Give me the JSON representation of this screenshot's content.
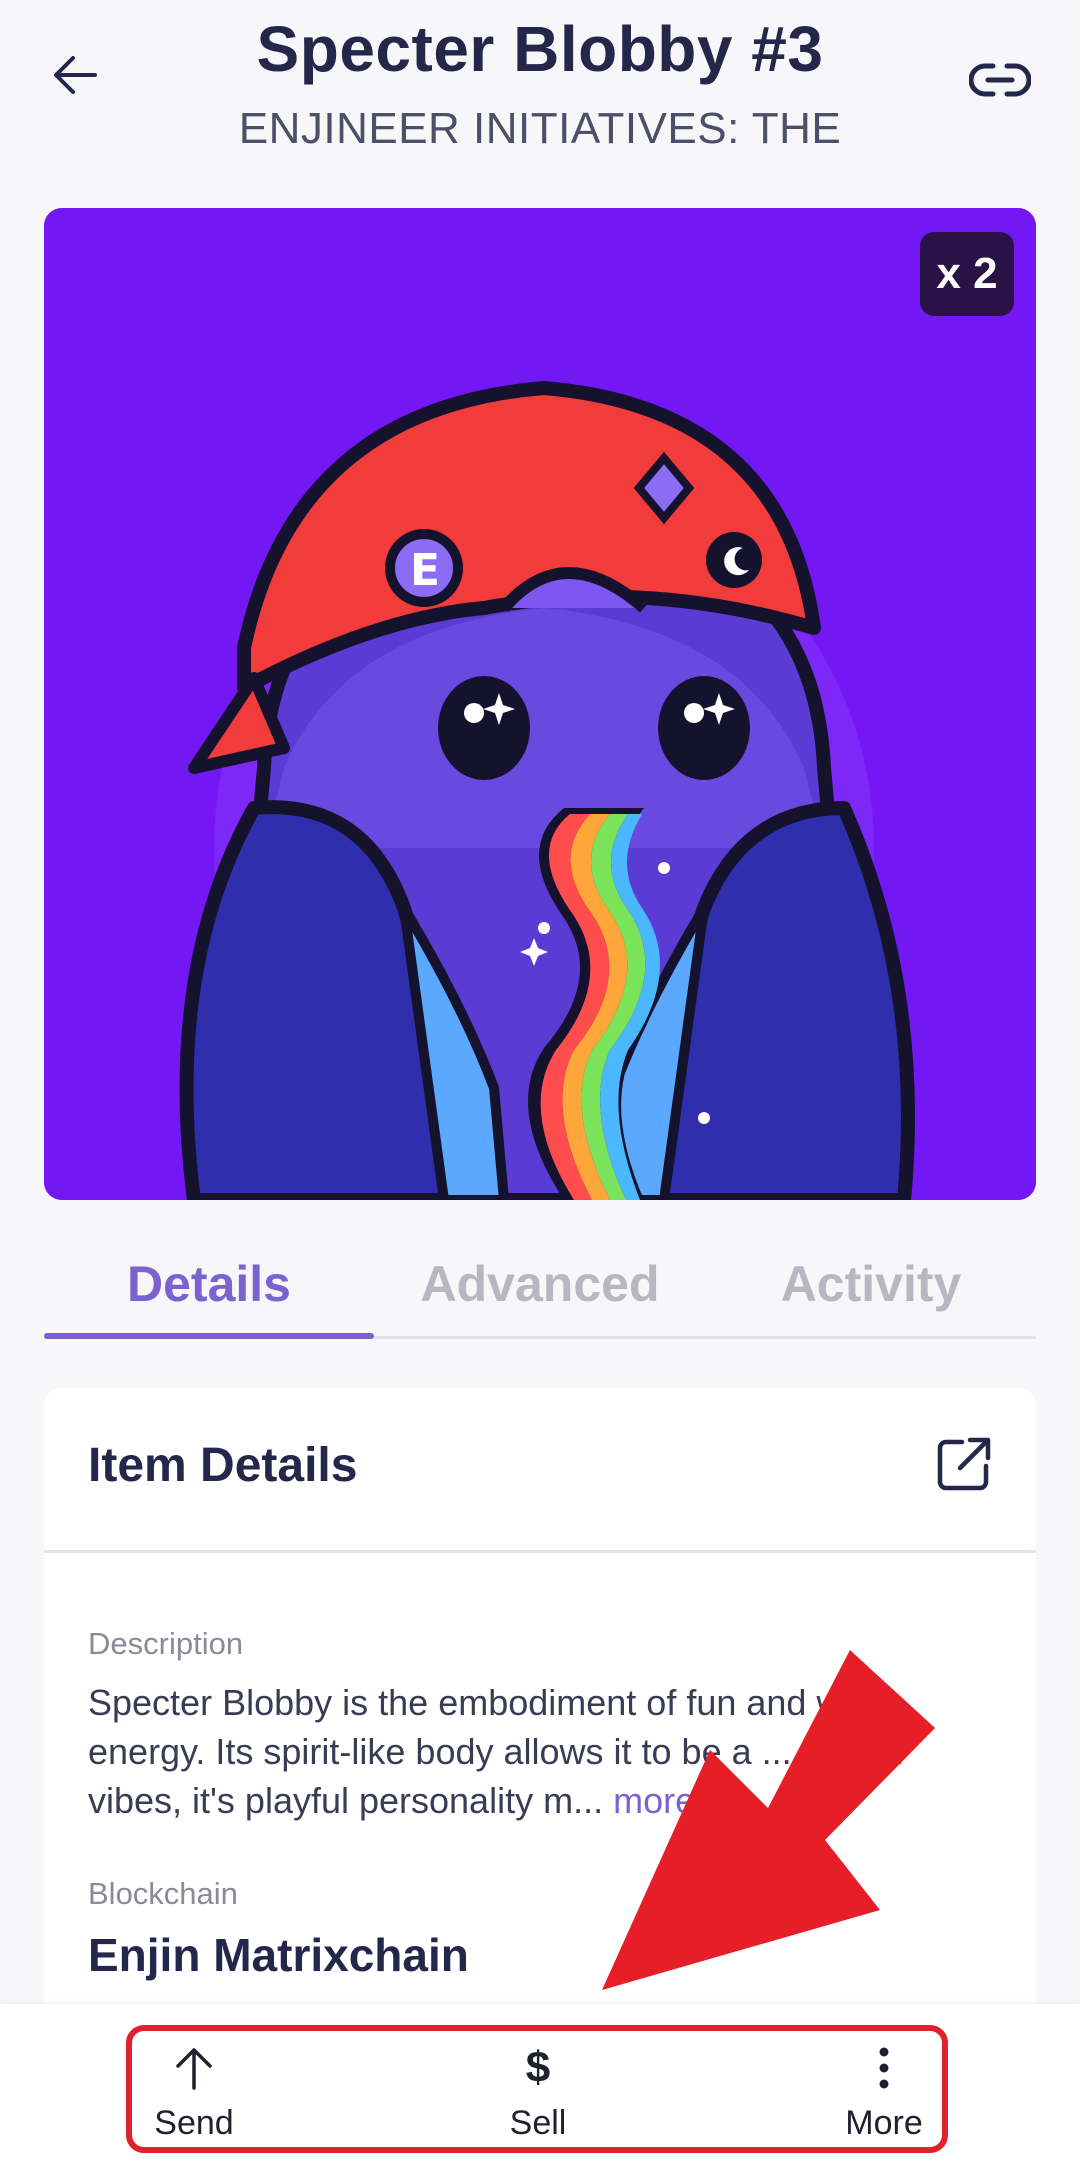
{
  "header": {
    "title": "Specter Blobby #3",
    "subtitle": "ENJINEER INITIATIVES: THE"
  },
  "nft": {
    "quantity_badge": "x 2",
    "background_color": "#7417f5"
  },
  "tabs": [
    {
      "label": "Details",
      "active": true
    },
    {
      "label": "Advanced",
      "active": false
    },
    {
      "label": "Activity",
      "active": false
    }
  ],
  "item_details": {
    "title": "Item Details",
    "description_label": "Description",
    "description_text": "Specter Blobby is the embodiment of fun and wild energy. Its spirit-like body allows it to be a ... of chill vibes, it's playful personality m...",
    "more_link": "more",
    "blockchain_label": "Blockchain",
    "blockchain_value": "Enjin Matrixchain"
  },
  "actions": {
    "send_label": "Send",
    "sell_label": "Sell",
    "more_label": "More"
  },
  "colors": {
    "accent": "#7b63cf",
    "annotation": "#e0202a"
  },
  "icons": {
    "back": "arrow-left-icon",
    "link": "link-icon",
    "external": "external-link-icon",
    "send": "arrow-up-icon",
    "sell": "dollar-icon",
    "more": "dots-vertical-icon"
  }
}
